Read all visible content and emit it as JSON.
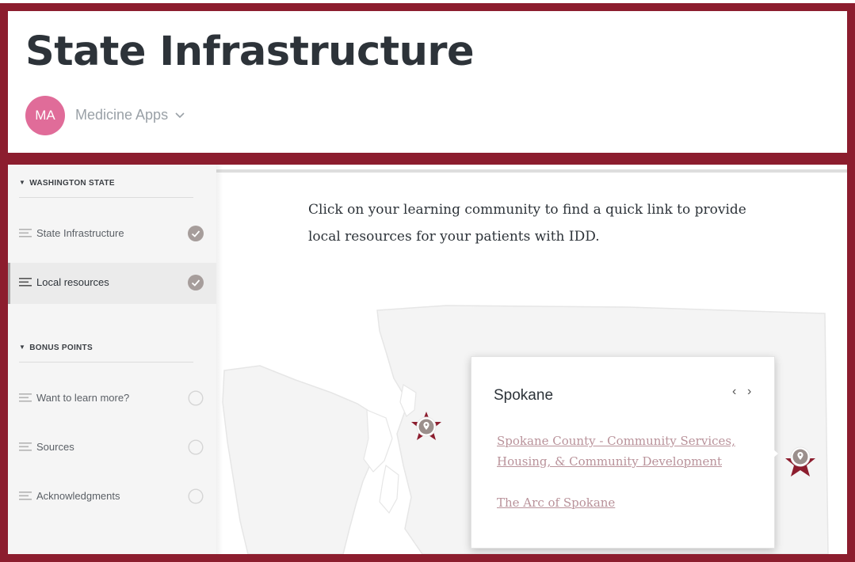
{
  "header": {
    "title": "State Infrastructure",
    "avatar_initials": "MA",
    "org_name": "Medicine Apps",
    "chevron_icon": "chevron-down-icon"
  },
  "colors": {
    "frame": "#8c1d2e",
    "avatar": "#e06c99",
    "link": "#b9929a",
    "marker_star": "#8c1d2e",
    "marker_pin": "#9b8f8c"
  },
  "sidebar": {
    "sections": [
      {
        "label": "WASHINGTON STATE",
        "items": [
          {
            "label": "State Infrastructure",
            "status": "complete",
            "active": false
          },
          {
            "label": "Local resources",
            "status": "complete",
            "active": true
          }
        ]
      },
      {
        "label": "BONUS POINTS",
        "items": [
          {
            "label": "Want to learn more?",
            "status": "incomplete",
            "active": false
          },
          {
            "label": "Sources",
            "status": "incomplete",
            "active": false
          },
          {
            "label": "Acknowledgments",
            "status": "incomplete",
            "active": false
          }
        ]
      }
    ]
  },
  "main": {
    "intro_text": "Click on your learning community to find a quick link to provide local resources for your patients with IDD.",
    "popup": {
      "title": "Spokane",
      "prev_label": "‹",
      "next_label": "›",
      "links": [
        "Spokane County - Community Services, Housing, & Community Development",
        "The Arc of Spokane"
      ]
    }
  }
}
